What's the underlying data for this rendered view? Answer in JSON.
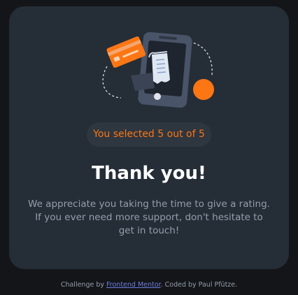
{
  "card": {
    "badge": "You selected 5 out of 5",
    "title": "Thank you!",
    "message": "We appreciate you taking the time to give a rating. If you ever need more support, don't hesitate to get in touch!"
  },
  "attribution": {
    "prefix": "Challenge by ",
    "link": "Frontend Mentor",
    "suffix": ". Coded by Paul Pfütze."
  },
  "colors": {
    "accent": "#fc7614",
    "card_background": "#252d37",
    "page_background": "#131518",
    "muted_text": "#959eac"
  }
}
